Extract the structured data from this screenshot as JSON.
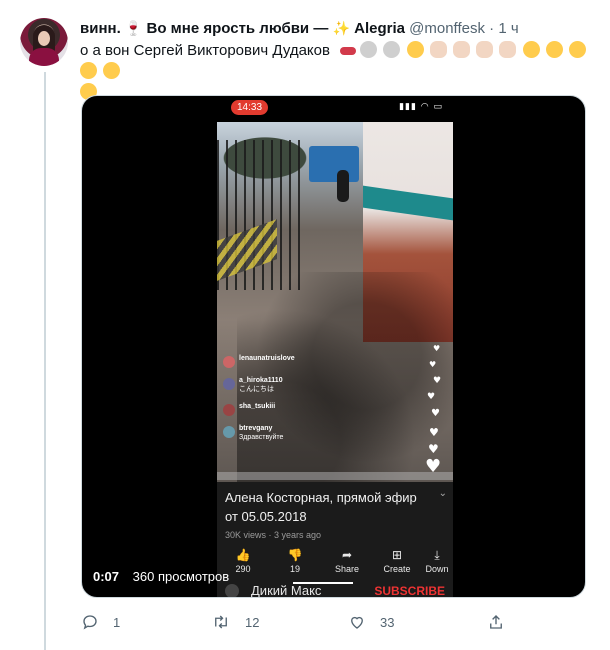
{
  "tweet": {
    "author_name": "винн.",
    "author_name_emoji": "🍷",
    "display_phrase": "Во мне ярость любви —",
    "sparkle_emoji": "✨",
    "display_suffix": "Alegria",
    "handle": "@monffesk",
    "separator": "·",
    "time": "1 ч",
    "text": "о а вон Сергей Викторович Дудаков",
    "emoji_sequence": [
      "lips",
      "gray-face",
      "gray-face",
      "smirk-face",
      "victory-hand",
      "victory-hand",
      "victory-hand",
      "victory-hand",
      "yawning-face",
      "yawning-face",
      "yawning-face",
      "rofl-face",
      "rofl-face",
      "rofl-face"
    ]
  },
  "video": {
    "status_time": "14:33",
    "status_icons": "▮▮▮ ◠ ▭",
    "title": "Алена Косторная, прямой эфир от 05.05.2018",
    "meta": "30K views · 3 years ago",
    "chevron": "⌄",
    "actions": [
      {
        "icon": "thumbs-up-icon",
        "glyph": "👍",
        "label": "290"
      },
      {
        "icon": "thumbs-down-icon",
        "glyph": "👎",
        "label": "19"
      },
      {
        "icon": "share-icon",
        "glyph": "➦",
        "label": "Share"
      },
      {
        "icon": "create-icon",
        "glyph": "⊞",
        "label": "Create"
      },
      {
        "icon": "download-icon",
        "glyph": "⤓",
        "label": "Down"
      }
    ],
    "channel_name": "Дикий Макс",
    "subscribe": "SUBSCRIBE",
    "comments": [
      {
        "user": "lenaunatruislove",
        "message": ""
      },
      {
        "user": "a_hiroka1110",
        "message": "こんにちは"
      },
      {
        "user": "sha_tsukiii",
        "message": ""
      },
      {
        "user": "btrevgany",
        "message": "Здравствуйте"
      }
    ],
    "overlay_time": "0:07",
    "overlay_views": "360 просмотров",
    "colors": {
      "accent": "#e23b2f",
      "background": "#000000"
    }
  },
  "actions": {
    "replies": "1",
    "retweets": "12",
    "likes": "33"
  }
}
